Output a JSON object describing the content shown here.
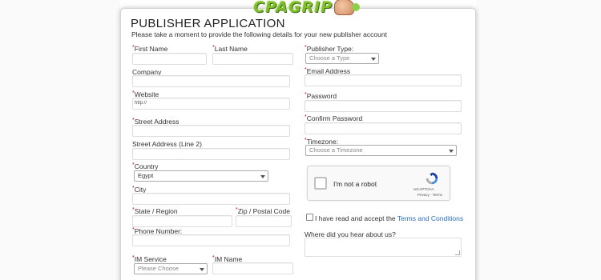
{
  "logo": {
    "text": "CPAGRIP"
  },
  "header": {
    "title": "PUBLISHER APPLICATION",
    "subtitle": "Please take a moment to provide the following details for your new publisher account"
  },
  "required_marker": "*",
  "left": {
    "first_name": {
      "label": "First Name",
      "value": ""
    },
    "last_name": {
      "label": "Last Name",
      "value": ""
    },
    "company": {
      "label": "Company",
      "value": ""
    },
    "website": {
      "label": "Website",
      "value": "http://"
    },
    "street_address": {
      "label": "Street Address",
      "value": ""
    },
    "street_address_2": {
      "label": "Street Address (Line 2)",
      "value": ""
    },
    "country": {
      "label": "Country",
      "value": "Egypt"
    },
    "city": {
      "label": "City",
      "value": ""
    },
    "state": {
      "label": "State / Region",
      "value": ""
    },
    "zip": {
      "label": "Zip / Postal Code",
      "value": ""
    },
    "phone": {
      "label": "Phone Number:",
      "value": ""
    },
    "im_service": {
      "label": "IM Service",
      "value": "Please Choose"
    },
    "im_name": {
      "label": "IM Name",
      "value": ""
    }
  },
  "right": {
    "publisher_type": {
      "label": "Publisher Type:",
      "value": "Choose a Type"
    },
    "email": {
      "label": "Email Address",
      "value": ""
    },
    "password": {
      "label": "Password",
      "value": ""
    },
    "confirm_password": {
      "label": "Confirm Password",
      "value": ""
    },
    "timezone": {
      "label": "Timezone:",
      "value": "Choose a Timezone"
    },
    "recaptcha": {
      "label": "I'm not a robot",
      "brand": "reCAPTCHA",
      "links": "Privacy - Terms",
      "checked": false
    },
    "terms": {
      "prefix": "I have read and accept the ",
      "link": "Terms and Conditions",
      "checked": false
    },
    "heard_about": {
      "label": "Where did you hear about us?",
      "value": ""
    }
  },
  "colors": {
    "accent_link": "#2a6ebb",
    "required": "#cc0000",
    "logo_green": "#7fbf2e"
  }
}
